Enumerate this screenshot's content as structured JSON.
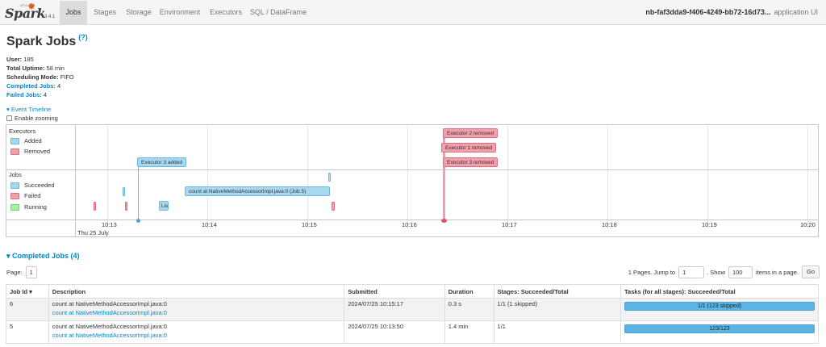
{
  "nav": {
    "brand_name": "Spark",
    "brand_small": "APACHE",
    "version": "3.4.1",
    "tabs": [
      "Jobs",
      "Stages",
      "Storage",
      "Environment",
      "Executors",
      "SQL / DataFrame"
    ],
    "active_tab": "Jobs",
    "app_name": "nb-faf3dda9-f406-4249-bb72-16d73...",
    "app_suffix": "application UI"
  },
  "header": {
    "title": "Spark Jobs",
    "help": "(?)"
  },
  "summary": {
    "user_label": "User:",
    "user_value": "185",
    "uptime_label": "Total Uptime:",
    "uptime_value": "58 min",
    "mode_label": "Scheduling Mode:",
    "mode_value": "FIFO",
    "completed_label": "Completed Jobs:",
    "completed_value": "4",
    "failed_label": "Failed Jobs:",
    "failed_value": "4"
  },
  "timeline": {
    "toggle_label": "Event Timeline",
    "zoom_label": "Enable zooming",
    "executors_title": "Executors",
    "jobs_title": "Jobs",
    "legend": {
      "added": "Added",
      "removed": "Removed",
      "succeeded": "Succeeded",
      "failed": "Failed",
      "running": "Running"
    },
    "axis_ticks": [
      "10:13",
      "10:14",
      "10:15",
      "10:16",
      "10:17",
      "10:18",
      "10:19",
      "10:20"
    ],
    "axis_date": "Thu 25 July",
    "events": {
      "exec3_added": "Executor 3 added",
      "exec2_removed": "Executor 2 removed",
      "exec1_removed": "Executor 1 removed",
      "exec3_removed": "Executor 3 removed",
      "job5": "count at NativeMethodAccessorImpl.java:0 (Job 5)",
      "lis": "Lis"
    }
  },
  "completed": {
    "title": "Completed Jobs (4)",
    "page_label": "Page:",
    "page_value": "1",
    "pages_text": "1 Pages. Jump to",
    "jump_value": "1",
    "show_text": ". Show",
    "show_value": "100",
    "items_text": "items in a page.",
    "go_label": "Go",
    "columns": {
      "id": "Job Id ▾",
      "desc": "Description",
      "submitted": "Submitted",
      "duration": "Duration",
      "stages": "Stages: Succeeded/Total",
      "tasks": "Tasks (for all stages): Succeeded/Total"
    },
    "rows": [
      {
        "id": "6",
        "desc": "count at NativeMethodAccessorImpl.java:0",
        "link": "count at NativeMethodAccessorImpl.java:0",
        "submitted": "2024/07/25 10:15:17",
        "duration": "0.3 s",
        "stages": "1/1 (1 skipped)",
        "tasks": "1/1 (123 skipped)"
      },
      {
        "id": "5",
        "desc": "count at NativeMethodAccessorImpl.java:0",
        "link": "count at NativeMethodAccessorImpl.java:0",
        "submitted": "2024/07/25 10:13:50",
        "duration": "1.4 min",
        "stages": "1/1",
        "tasks": "123/123"
      }
    ]
  }
}
